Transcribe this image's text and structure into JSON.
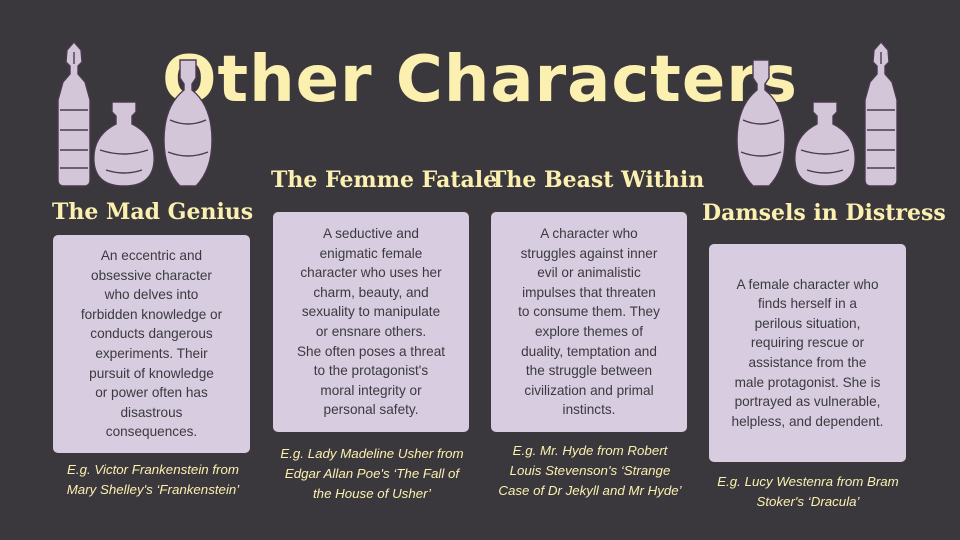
{
  "title": "Other Characters",
  "columns": [
    {
      "heading": "The Mad Genius",
      "description": "An eccentric and\nobsessive character\nwho delves into\nforbidden knowledge or\nconducts dangerous\nexperiments. Their\npursuit of knowledge\nor power often has\ndisastrous\nconsequences.",
      "example": "E.g. Victor Frankenstein from\nMary Shelley's ‘Frankenstein’"
    },
    {
      "heading": "The Femme Fatale",
      "description": "A seductive and\nenigmatic female\ncharacter who uses her\ncharm, beauty, and\nsexuality to manipulate\nor ensnare others.\nShe often poses a threat\nto the protagonist's\nmoral integrity or\npersonal safety.",
      "example": "E.g. Lady Madeline Usher from\nEdgar Allan Poe's ‘The Fall of\nthe House of Usher’"
    },
    {
      "heading": "The Beast Within",
      "description": "A character who\nstruggles against inner\nevil or animalistic\nimpulses that threaten\nto consume them. They\nexplore themes of\nduality, temptation and\nthe struggle between\ncivilization and primal\ninstincts.",
      "example": "E.g.  Mr. Hyde from Robert\nLouis Stevenson's ‘Strange\nCase of Dr Jekyll and Mr Hyde’"
    },
    {
      "heading": "Damsels in Distress",
      "description": "A female character who\nfinds herself in a\nperilous situation,\nrequiring rescue or\nassistance from the\nmale protagonist. She is\nportrayed as vulnerable,\nhelpless, and dependent.",
      "example": "E.g. Lucy Westenra from  Bram\nStoker's ‘Dracula’"
    }
  ],
  "icons": {
    "decoration_left": "potion-bottles-icon",
    "decoration_right": "potion-bottles-icon"
  },
  "colors": {
    "background": "#3a383c",
    "accent": "#fbf0b0",
    "card": "#d7cce0",
    "card_text": "#3b3a3e"
  }
}
